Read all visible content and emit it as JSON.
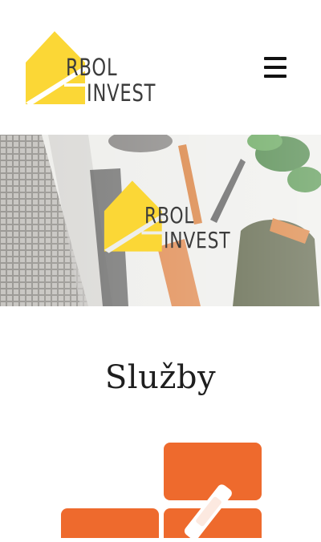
{
  "brand": {
    "name_line1": "RBOL",
    "name_line2": "INVEST",
    "accent_color": "#fbd736",
    "text_color": "#3c3c3c"
  },
  "header": {
    "menu_icon": "hamburger-menu-icon"
  },
  "hero": {
    "logo_line1": "RBOL",
    "logo_line2": "INVEST"
  },
  "services": {
    "title": "Služby",
    "icon": "tools-icon",
    "icon_color": "#ee6a2d"
  }
}
